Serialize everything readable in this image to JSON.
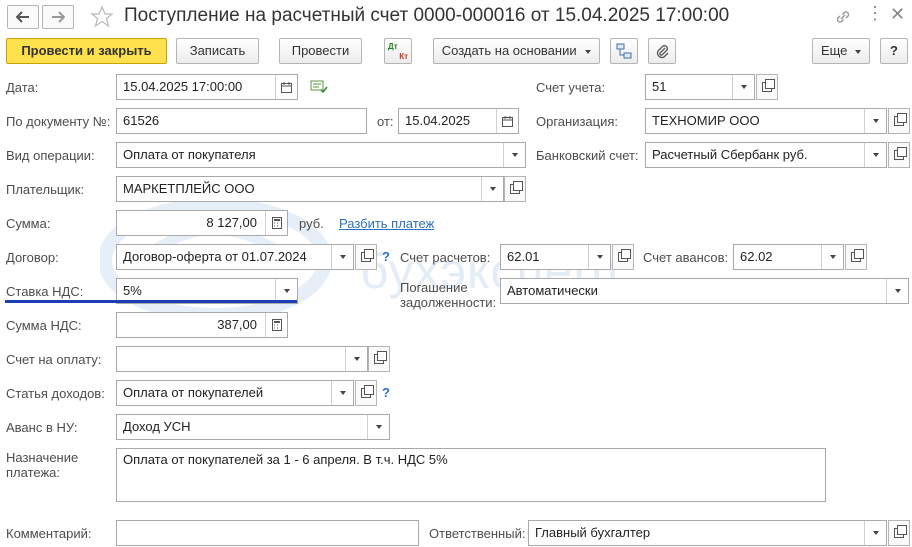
{
  "window": {
    "title": "Поступление на расчетный счет 0000-000016 от 15.04.2025 17:00:00"
  },
  "toolbar": {
    "post_close": "Провести и закрыть",
    "save": "Записать",
    "post": "Провести",
    "dtkt_top": "Дт",
    "dtkt_bottom": "Кт",
    "create_based": "Создать на основании",
    "more": "Еще",
    "help": "?"
  },
  "form": {
    "date_label": "Дата:",
    "date_value": "15.04.2025 17:00:00",
    "account_label": "Счет учета:",
    "account_value": "51",
    "docnum_label": "По документу №:",
    "docnum_value": "61526",
    "from_label": "от:",
    "from_value": "15.04.2025",
    "org_label": "Организация:",
    "org_value": "ТЕХНОМИР ООО",
    "optype_label": "Вид операции:",
    "optype_value": "Оплата от покупателя",
    "bank_label": "Банковский счет:",
    "bank_value": "Расчетный Сбербанк руб.",
    "payer_label": "Плательщик:",
    "payer_value": "МАРКЕТПЛЕЙС ООО",
    "sum_label": "Сумма:",
    "sum_value": "8 127,00",
    "currency": "руб.",
    "split_link": "Разбить платеж",
    "contract_label": "Договор:",
    "contract_value": "Договор-оферта от 01.07.2024",
    "settle_label": "Счет расчетов:",
    "settle_value": "62.01",
    "advance_label": "Счет авансов:",
    "advance_value": "62.02",
    "vatrate_label": "Ставка НДС:",
    "vatrate_value": "5%",
    "repay_label_1": "Погашение",
    "repay_label_2": "задолженности:",
    "repay_value": "Автоматически",
    "vatsum_label": "Сумма НДС:",
    "vatsum_value": "387,00",
    "invoice_label": "Счет на оплату:",
    "invoice_value": "",
    "income_label": "Статья доходов:",
    "income_value": "Оплата от покупателей",
    "advnu_label": "Аванс в НУ:",
    "advnu_value": "Доход УСН",
    "purpose_label_1": "Назначение",
    "purpose_label_2": "платежа:",
    "purpose_value": "Оплата от покупателей за 1 - 6 апреля. В т.ч. НДС 5%",
    "comment_label": "Комментарий:",
    "comment_value": "",
    "responsible_label": "Ответственный:",
    "responsible_value": "Главный бухгалтер",
    "help_mark": "?"
  },
  "watermark": "бухэксперт",
  "colors": {
    "primary_button": "#ffe04d",
    "link": "#2f6fbf",
    "highlight_underline": "#1a3fb5"
  }
}
